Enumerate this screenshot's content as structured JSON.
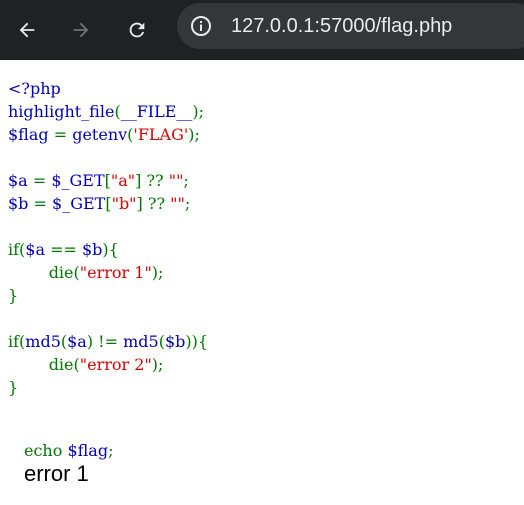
{
  "browser": {
    "url": "127.0.0.1:57000/flag.php",
    "icons": {
      "back": "arrow-left-icon",
      "forward": "arrow-right-icon",
      "reload": "reload-icon",
      "site_info": "info-icon"
    },
    "colors": {
      "toolbar_bg": "#202124",
      "address_bg": "#35363a",
      "url_text": "#e8eaed",
      "icon_active": "#e8eaed",
      "icon_disabled": "#6f7175"
    }
  },
  "code": {
    "colors": {
      "default": "#0000bb",
      "keyword": "#007700",
      "string": "#dd0000"
    },
    "lines": [
      [
        [
          "default",
          "<?php"
        ]
      ],
      [
        [
          "default",
          "highlight_file"
        ],
        [
          "keyword",
          "("
        ],
        [
          "default",
          "__FILE__"
        ],
        [
          "keyword",
          ");"
        ]
      ],
      [
        [
          "default",
          "$flag "
        ],
        [
          "keyword",
          "= "
        ],
        [
          "default",
          "getenv"
        ],
        [
          "keyword",
          "("
        ],
        [
          "string",
          "'FLAG'"
        ],
        [
          "keyword",
          ");"
        ]
      ],
      [],
      [
        [
          "default",
          "$a "
        ],
        [
          "keyword",
          "= "
        ],
        [
          "default",
          "$_GET"
        ],
        [
          "keyword",
          "["
        ],
        [
          "string",
          "\"a\""
        ],
        [
          "keyword",
          "] ?? "
        ],
        [
          "string",
          "\"\""
        ],
        [
          "keyword",
          ";"
        ]
      ],
      [
        [
          "default",
          "$b "
        ],
        [
          "keyword",
          "= "
        ],
        [
          "default",
          "$_GET"
        ],
        [
          "keyword",
          "["
        ],
        [
          "string",
          "\"b\""
        ],
        [
          "keyword",
          "] ?? "
        ],
        [
          "string",
          "\"\""
        ],
        [
          "keyword",
          ";"
        ]
      ],
      [],
      [
        [
          "keyword",
          "if("
        ],
        [
          "default",
          "$a "
        ],
        [
          "keyword",
          "== "
        ],
        [
          "default",
          "$b"
        ],
        [
          "keyword",
          "){"
        ]
      ],
      [
        [
          "keyword",
          "        die("
        ],
        [
          "string",
          "\"error 1\""
        ],
        [
          "keyword",
          ");"
        ]
      ],
      [
        [
          "keyword",
          "}"
        ]
      ],
      [],
      [
        [
          "keyword",
          "if("
        ],
        [
          "default",
          "md5"
        ],
        [
          "keyword",
          "("
        ],
        [
          "default",
          "$a"
        ],
        [
          "keyword",
          ") != "
        ],
        [
          "default",
          "md5"
        ],
        [
          "keyword",
          "("
        ],
        [
          "default",
          "$b"
        ],
        [
          "keyword",
          ")){"
        ]
      ],
      [
        [
          "keyword",
          "        die("
        ],
        [
          "string",
          "\"error 2\""
        ],
        [
          "keyword",
          ");"
        ]
      ],
      [
        [
          "keyword",
          "}"
        ]
      ],
      []
    ],
    "echo_line": [
      [
        "keyword",
        "echo "
      ],
      [
        "default",
        "$flag"
      ],
      [
        "keyword",
        ";"
      ]
    ]
  },
  "output": {
    "text": "error 1"
  }
}
